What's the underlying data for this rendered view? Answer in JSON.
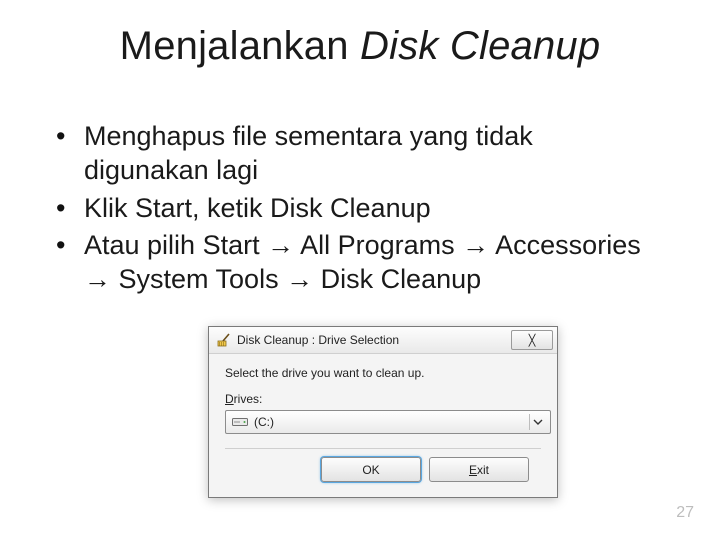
{
  "slide": {
    "title_regular": "Menjalankan ",
    "title_italic": "Disk Cleanup",
    "bullets": [
      "Menghapus file sementara yang tidak digunakan lagi",
      "Klik Start, ketik Disk Cleanup",
      "Atau pilih Start → All Programs → Accessories → System Tools → Disk Cleanup"
    ],
    "page_number": "27"
  },
  "dialog": {
    "title": "Disk Cleanup : Drive Selection",
    "close_char": "╳",
    "instruction": "Select the drive you want to clean up.",
    "drives_label_u": "D",
    "drives_label_rest": "rives:",
    "selected_drive": "(C:)",
    "ok_label": "OK",
    "exit_u": "E",
    "exit_rest": "xit"
  }
}
